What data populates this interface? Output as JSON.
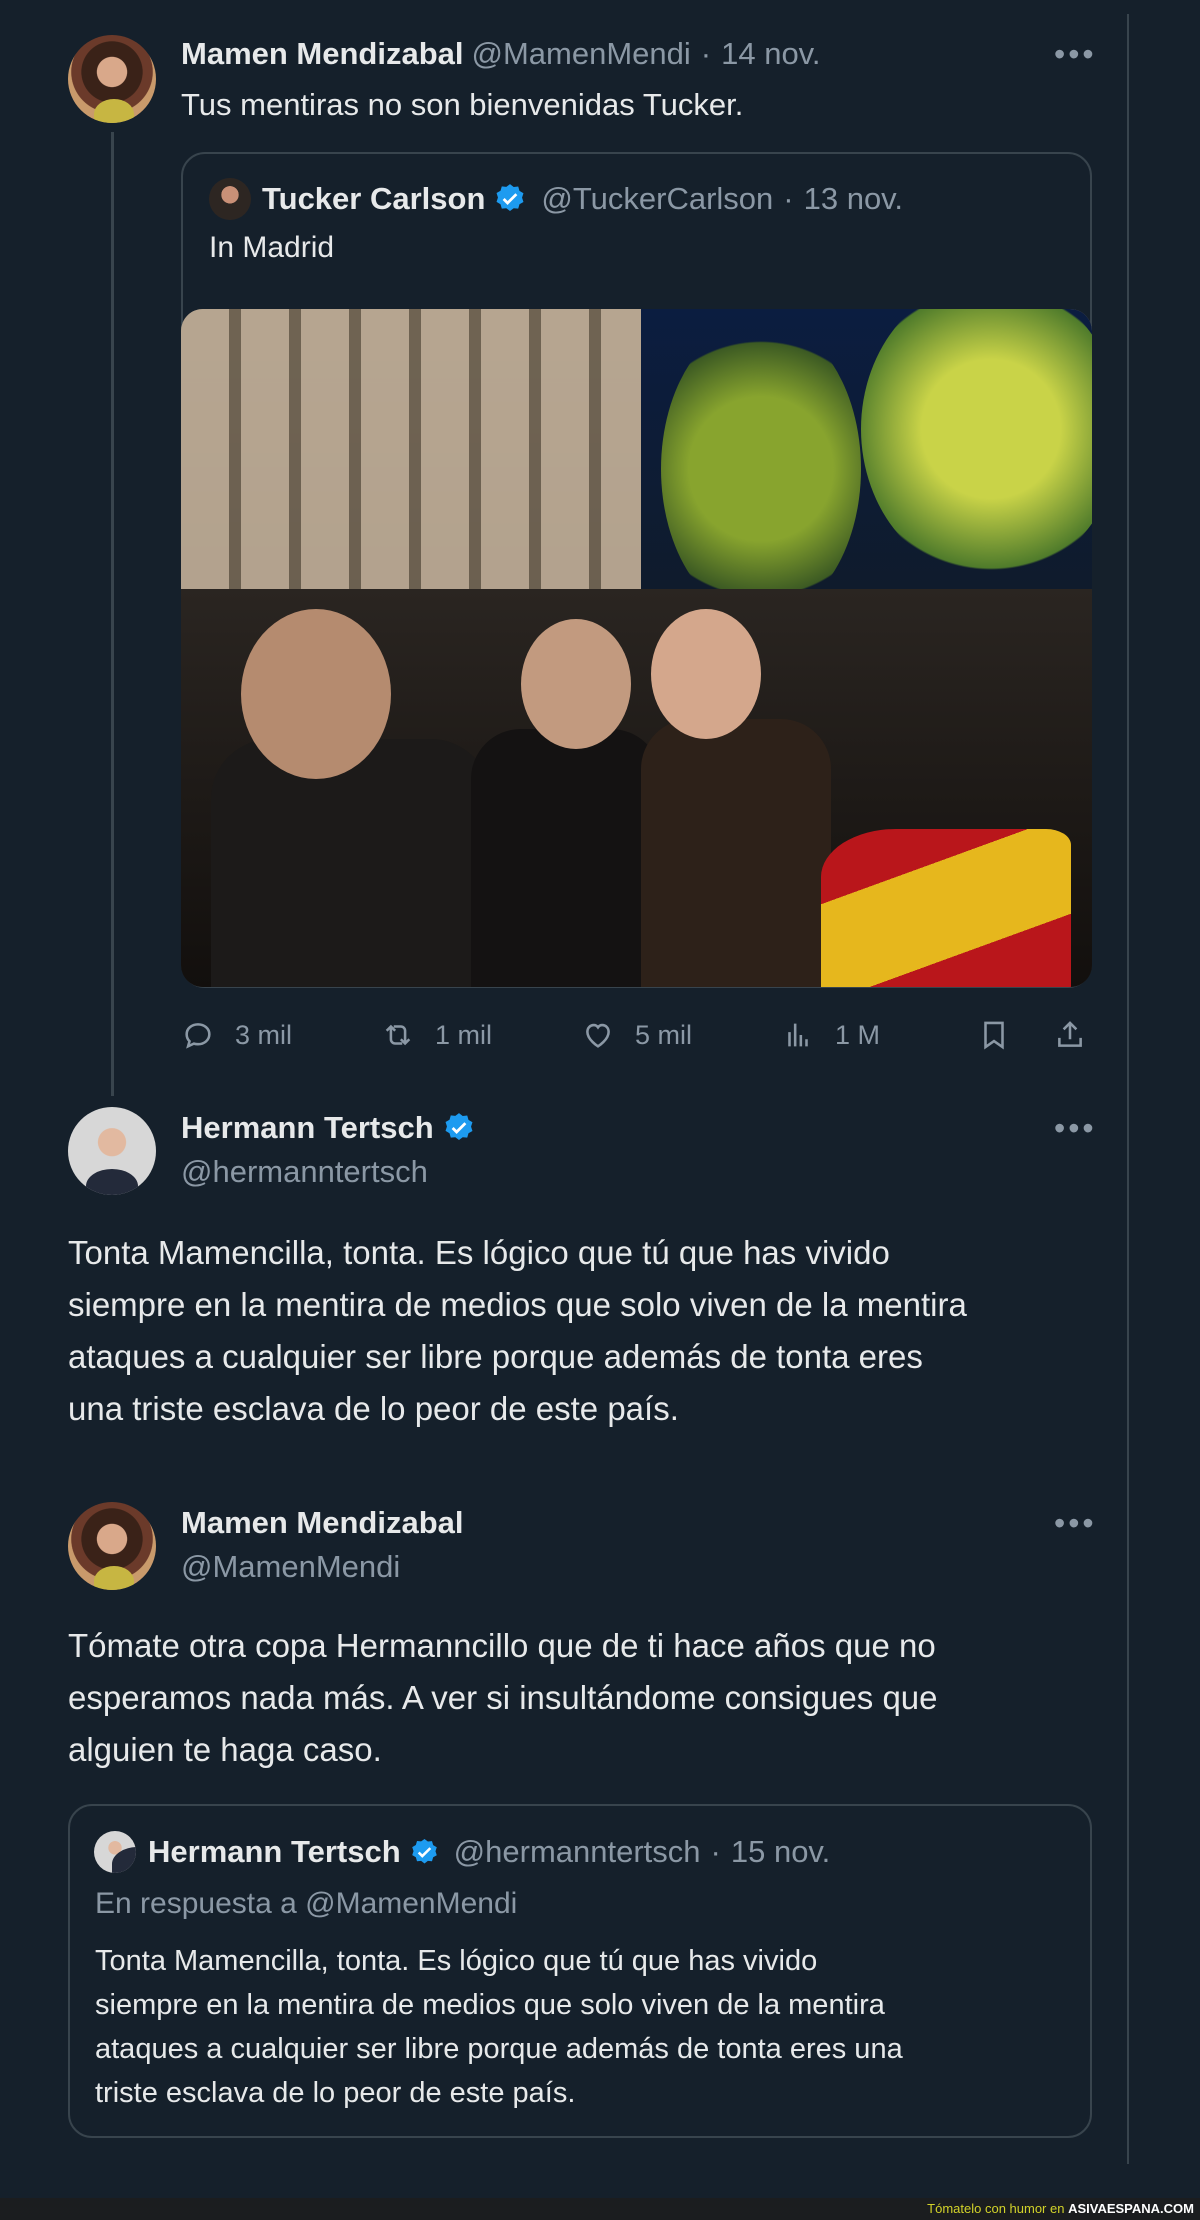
{
  "tweet1": {
    "name": "Mamen Mendizabal",
    "handle": "@MamenMendi",
    "dot": "·",
    "date": "14 nov.",
    "text": "Tus mentiras no son bienvenidas Tucker.",
    "more_icon": "more-horizontal-icon"
  },
  "quoted1": {
    "name": "Tucker Carlson",
    "verified": true,
    "handle": "@TuckerCarlson",
    "dot": "·",
    "date": "13 nov.",
    "text": "In Madrid",
    "image_alt": "Photo of a crowd at night on a Madrid street"
  },
  "actions1": {
    "replies": "3 mil",
    "reposts": "1 mil",
    "likes": "5 mil",
    "views": "1 M"
  },
  "tweet2": {
    "name": "Hermann Tertsch",
    "verified": true,
    "handle": "@hermanntertsch",
    "line1": "Tonta Mamencilla, tonta. Es lógico que tú que has vivido",
    "line2": "siempre en la mentira de medios que solo viven de la mentira",
    "line3": "ataques a cualquier ser libre porque además de tonta eres",
    "line4": "una triste esclava de lo peor de este país."
  },
  "tweet3": {
    "name": "Mamen Mendizabal",
    "handle": "@MamenMendi",
    "line1": "Tómate otra copa Hermanncillo que de ti hace años que no",
    "line2": "esperamos nada más. A ver si insultándome consigues que",
    "line3": "alguien te haga caso."
  },
  "quoted2": {
    "name": "Hermann Tertsch",
    "verified": true,
    "handle": "@hermanntertsch",
    "dot": "·",
    "date": "15 nov.",
    "reply_to": "En respuesta a @MamenMendi",
    "line1": "Tonta Mamencilla, tonta. Es lógico que tú que has vivido",
    "line2": "siempre en la mentira de medios que solo viven de la mentira",
    "line3": "ataques a cualquier ser libre porque además de tonta eres una",
    "line4": "triste esclava de lo peor de este país."
  },
  "footer": {
    "prefix": "Tómatelo con humor en",
    "site": "ASIVAESPANA.COM"
  },
  "colors": {
    "background": "#15202b",
    "text": "#e7e9ea",
    "muted": "#8b98a5",
    "border": "#38444d",
    "verified": "#1d9bf0"
  }
}
